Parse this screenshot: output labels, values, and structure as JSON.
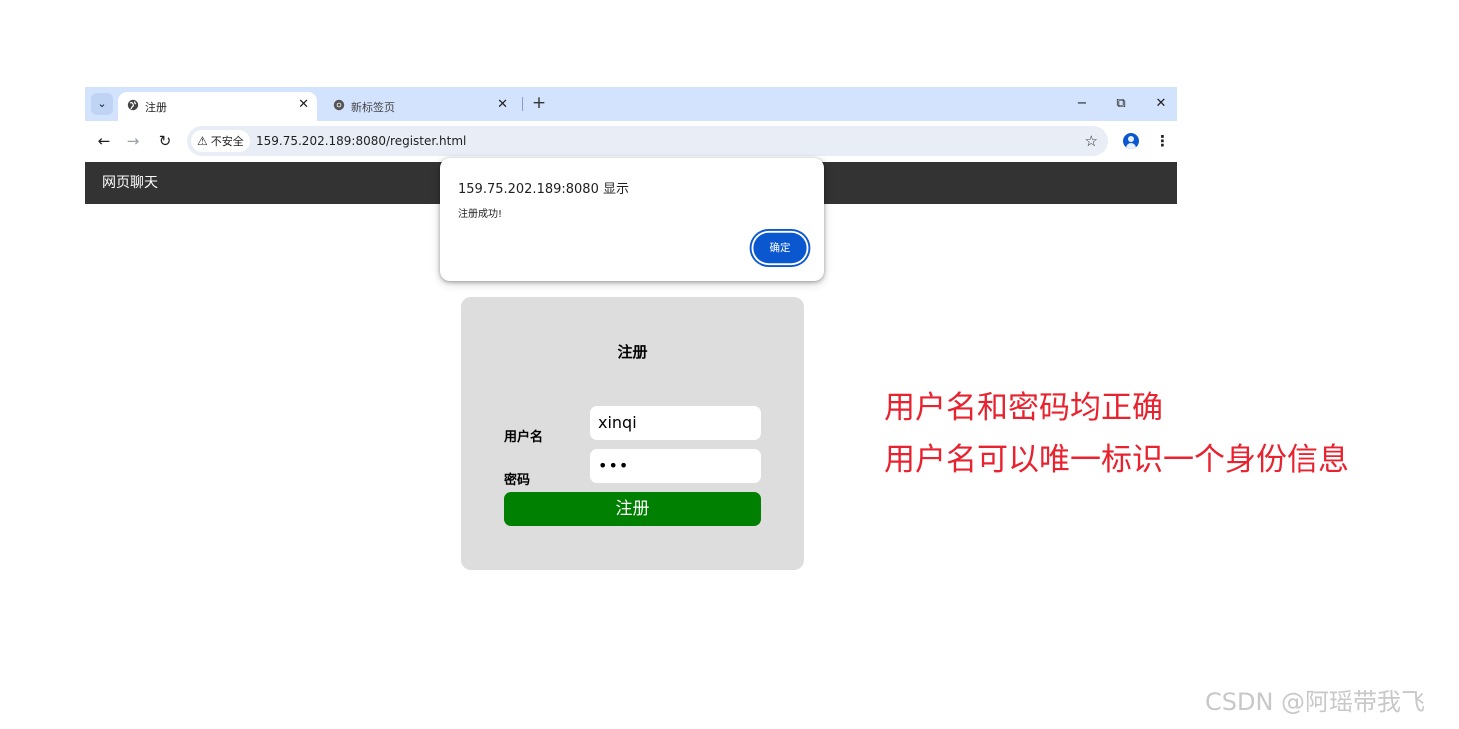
{
  "browser": {
    "tab_list_icon": "chevron-down-icon",
    "tabs": [
      {
        "title": "注册",
        "favicon": "globe-icon",
        "active": true
      },
      {
        "title": "新标签页",
        "favicon": "chrome-icon",
        "active": false
      }
    ],
    "new_tab_label": "+",
    "window_controls": {
      "minimize": "−",
      "restore": "⧉",
      "close": "✕"
    },
    "nav": {
      "back": "←",
      "forward": "→",
      "reload": "↻"
    },
    "security_label": "不安全",
    "url": "159.75.202.189:8080/register.html",
    "bookmark_icon": "☆",
    "menu_icon": "⋮"
  },
  "site": {
    "nav_title": "网页聊天"
  },
  "register_form": {
    "title": "注册",
    "username_label": "用户名",
    "username_value": "xinqi",
    "password_label": "密码",
    "password_value": "•••",
    "submit_label": "注册"
  },
  "alert": {
    "origin": "159.75.202.189:8080 显示",
    "message": "注册成功!",
    "ok_label": "确定"
  },
  "annotations": [
    "用户名和密码均正确",
    "用户名可以唯一标识一个身份信息"
  ],
  "watermark": "CSDN @阿瑶带我飞",
  "colors": {
    "tabstrip": "#d3e3fd",
    "navbar": "#333333",
    "card": "#dddddd",
    "submit": "#008000",
    "dialog_button": "#0b57d0",
    "annotation": "#e8232f"
  }
}
